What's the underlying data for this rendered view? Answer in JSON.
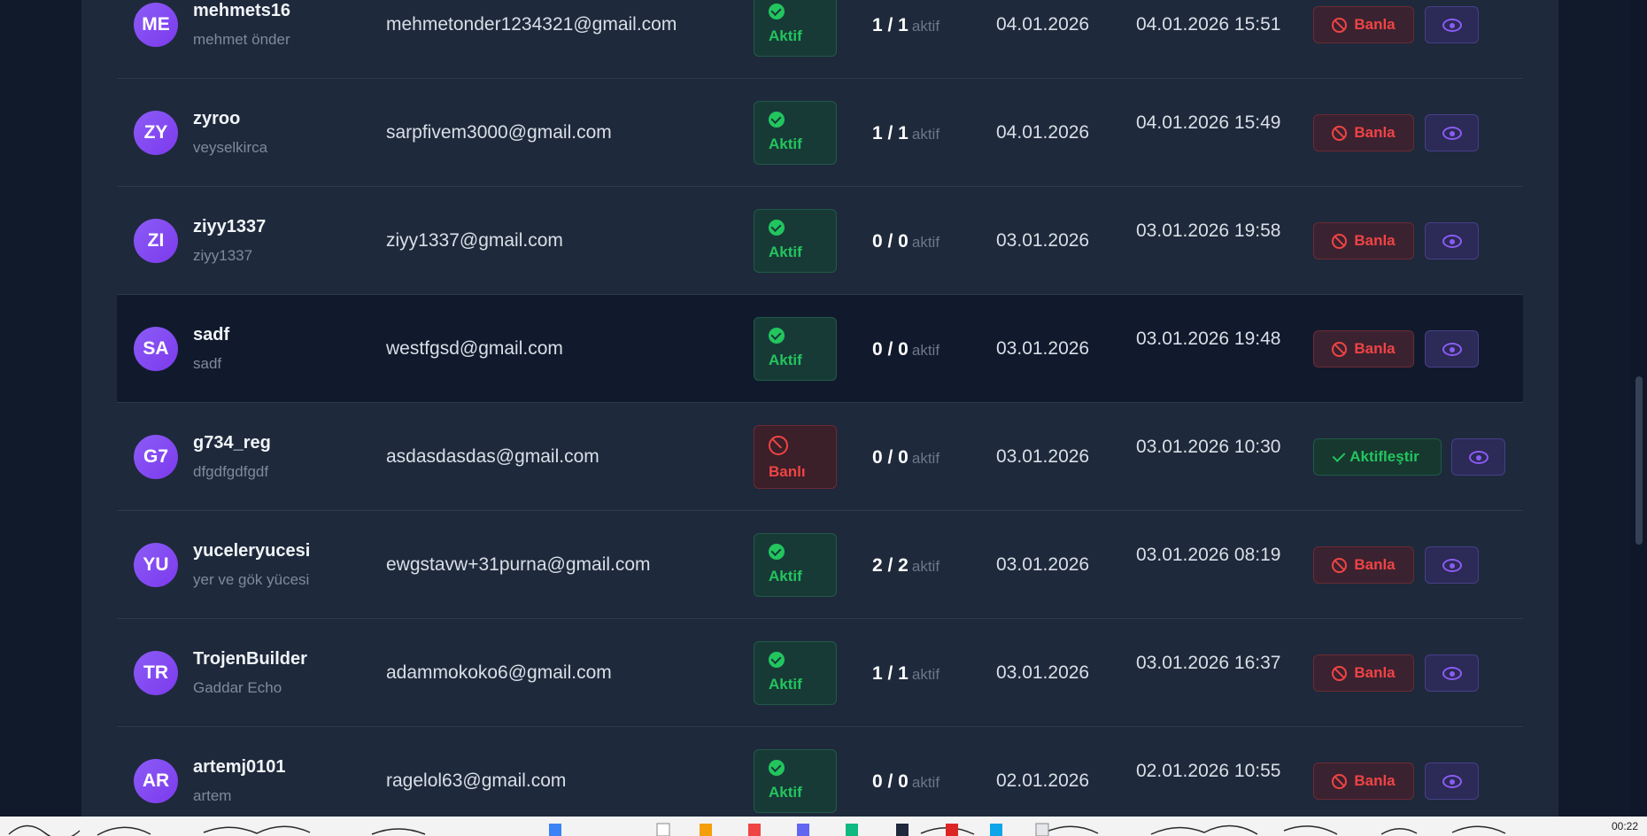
{
  "users": [
    {
      "initials": "ME",
      "username": "mehmets16",
      "display_name": "mehmet önder",
      "email": "mehmetonder1234321@gmail.com",
      "status": "Aktif",
      "sessions": "1 / 1",
      "sessions_label": "aktif",
      "registered": "04.01.2026",
      "last_login": "04.01.2026 15:51",
      "action": "Banla"
    },
    {
      "initials": "ZY",
      "username": "zyroo",
      "display_name": "veyselkirca",
      "email": "sarpfivem3000@gmail.com",
      "status": "Aktif",
      "sessions": "1 / 1",
      "sessions_label": "aktif",
      "registered": "04.01.2026",
      "last_login": "04.01.2026 15:49",
      "action": "Banla"
    },
    {
      "initials": "ZI",
      "username": "ziyy1337",
      "display_name": "ziyy1337",
      "email": "ziyy1337@gmail.com",
      "status": "Aktif",
      "sessions": "0 / 0",
      "sessions_label": "aktif",
      "registered": "03.01.2026",
      "last_login": "03.01.2026 19:58",
      "action": "Banla"
    },
    {
      "initials": "SA",
      "username": "sadf",
      "display_name": "sadf",
      "email": "westfgsd@gmail.com",
      "status": "Aktif",
      "sessions": "0 / 0",
      "sessions_label": "aktif",
      "registered": "03.01.2026",
      "last_login": "03.01.2026 19:48",
      "action": "Banla"
    },
    {
      "initials": "G7",
      "username": "g734_reg",
      "display_name": "dfgdfgdfgdf",
      "email": "asdasdasdas@gmail.com",
      "status": "Banlı",
      "sessions": "0 / 0",
      "sessions_label": "aktif",
      "registered": "03.01.2026",
      "last_login": "03.01.2026 10:30",
      "action": "Aktifleştir"
    },
    {
      "initials": "YU",
      "username": "yuceleryucesi",
      "display_name": "yer ve gök yücesi",
      "email": "ewgstavw+31purna@gmail.com",
      "status": "Aktif",
      "sessions": "2 / 2",
      "sessions_label": "aktif",
      "registered": "03.01.2026",
      "last_login": "03.01.2026 08:19",
      "action": "Banla"
    },
    {
      "initials": "TR",
      "username": "TrojenBuilder",
      "display_name": "Gaddar Echo",
      "email": "adammokoko6@gmail.com",
      "status": "Aktif",
      "sessions": "1 / 1",
      "sessions_label": "aktif",
      "registered": "03.01.2026",
      "last_login": "03.01.2026 16:37",
      "action": "Banla"
    },
    {
      "initials": "AR",
      "username": "artemj0101",
      "display_name": "artem",
      "email": "ragelol63@gmail.com",
      "status": "Aktif",
      "sessions": "0 / 0",
      "sessions_label": "aktif",
      "registered": "02.01.2026",
      "last_login": "02.01.2026 10:55",
      "action": "Banla"
    }
  ],
  "clock": "00:22",
  "colors": {
    "accent": "#8b5cf6",
    "active": "#22c55e",
    "banned": "#ef4444"
  }
}
